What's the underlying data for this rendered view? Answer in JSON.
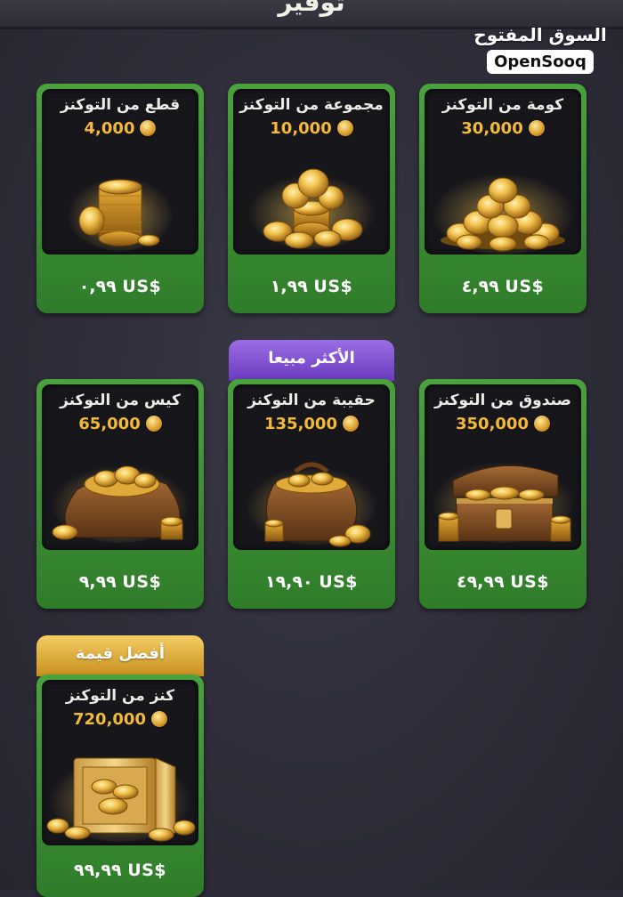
{
  "header": {
    "title": "توفير"
  },
  "watermark": {
    "arabic": "السوق المفتوح",
    "english": "OpenSooq"
  },
  "badges": {
    "best_seller": "الأكثر مبيعا",
    "best_value": "أفضل قيمة"
  },
  "packages": [
    {
      "title": "كومة من التوكنز",
      "amount": "30,000",
      "price": "٤,٩٩ US$",
      "icon": "coin-pile-icon"
    },
    {
      "title": "مجموعة من التوكنز",
      "amount": "10,000",
      "price": "١,٩٩ US$",
      "icon": "coin-group-icon"
    },
    {
      "title": "قطع من التوكنز",
      "amount": "4,000",
      "price": "٠,٩٩ US$",
      "icon": "coin-stack-icon"
    },
    {
      "title": "صندوق من التوكنز",
      "amount": "350,000",
      "price": "٤٩,٩٩ US$",
      "icon": "treasure-chest-icon"
    },
    {
      "title": "حقيبة من التوكنز",
      "amount": "135,000",
      "price": "١٩,٩٠ US$",
      "icon": "coin-purse-icon"
    },
    {
      "title": "كيس من التوكنز",
      "amount": "65,000",
      "price": "٩,٩٩ US$",
      "icon": "coin-sack-icon"
    },
    {
      "title": "كنز من التوكنز",
      "amount": "720,000",
      "price": "٩٩,٩٩ US$",
      "icon": "coin-safe-icon"
    }
  ],
  "colors": {
    "card_green": "#3e9435",
    "amount_gold": "#f2b93a",
    "badge_purple": "#7e4fd0",
    "badge_gold": "#e0aa3b",
    "background": "#2c2b37"
  }
}
